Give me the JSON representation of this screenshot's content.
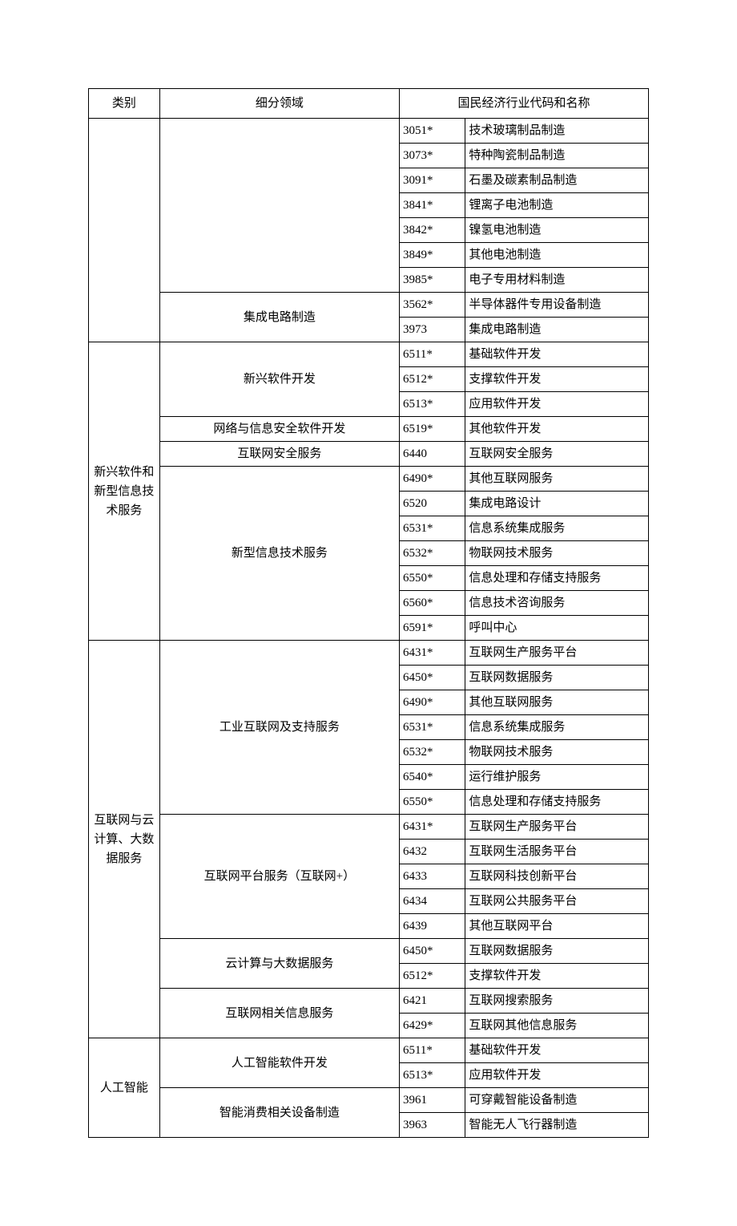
{
  "headers": {
    "category": "类别",
    "subfield": "细分领域",
    "codeName": "国民经济行业代码和名称"
  },
  "rows": [
    {
      "cat": "",
      "catSpan": 9,
      "sub": "",
      "subSpan": 7,
      "code": "3051*",
      "name": "技术玻璃制品制造"
    },
    {
      "code": "3073*",
      "name": "特种陶瓷制品制造"
    },
    {
      "code": "3091*",
      "name": "石墨及碳素制品制造"
    },
    {
      "code": "3841*",
      "name": "锂离子电池制造"
    },
    {
      "code": "3842*",
      "name": "镍氢电池制造"
    },
    {
      "code": "3849*",
      "name": "其他电池制造"
    },
    {
      "code": "3985*",
      "name": "电子专用材料制造"
    },
    {
      "sub": "集成电路制造",
      "subSpan": 2,
      "code": "3562*",
      "name": "半导体器件专用设备制造"
    },
    {
      "code": "3973",
      "name": "集成电路制造"
    },
    {
      "cat": "新兴软件和新型信息技术服务",
      "catSpan": 12,
      "sub": "新兴软件开发",
      "subSpan": 3,
      "code": "6511*",
      "name": "基础软件开发"
    },
    {
      "code": "6512*",
      "name": "支撑软件开发"
    },
    {
      "code": "6513*",
      "name": "应用软件开发"
    },
    {
      "sub": "网络与信息安全软件开发",
      "subSpan": 1,
      "code": "6519*",
      "name": "其他软件开发"
    },
    {
      "sub": "互联网安全服务",
      "subSpan": 1,
      "code": "6440",
      "name": "互联网安全服务"
    },
    {
      "sub": "新型信息技术服务",
      "subSpan": 7,
      "code": "6490*",
      "name": "其他互联网服务"
    },
    {
      "code": "6520",
      "name": "集成电路设计"
    },
    {
      "code": "6531*",
      "name": "信息系统集成服务"
    },
    {
      "code": "6532*",
      "name": "物联网技术服务"
    },
    {
      "code": "6550*",
      "name": "信息处理和存储支持服务"
    },
    {
      "code": "6560*",
      "name": "信息技术咨询服务"
    },
    {
      "code": "6591*",
      "name": "呼叫中心"
    },
    {
      "cat": "互联网与云计算、大数据服务",
      "catSpan": 16,
      "sub": "工业互联网及支持服务",
      "subSpan": 7,
      "code": "6431*",
      "name": "互联网生产服务平台"
    },
    {
      "code": "6450*",
      "name": "互联网数据服务"
    },
    {
      "code": "6490*",
      "name": "其他互联网服务"
    },
    {
      "code": "6531*",
      "name": "信息系统集成服务"
    },
    {
      "code": "6532*",
      "name": "物联网技术服务"
    },
    {
      "code": "6540*",
      "name": "运行维护服务"
    },
    {
      "code": "6550*",
      "name": "信息处理和存储支持服务"
    },
    {
      "sub": "互联网平台服务（互联网+）",
      "subSpan": 5,
      "code": "6431*",
      "name": "互联网生产服务平台"
    },
    {
      "code": "6432",
      "name": "互联网生活服务平台"
    },
    {
      "code": "6433",
      "name": "互联网科技创新平台"
    },
    {
      "code": "6434",
      "name": "互联网公共服务平台"
    },
    {
      "code": "6439",
      "name": "其他互联网平台"
    },
    {
      "sub": "云计算与大数据服务",
      "subSpan": 2,
      "code": "6450*",
      "name": "互联网数据服务"
    },
    {
      "code": "6512*",
      "name": "支撑软件开发"
    },
    {
      "sub": "互联网相关信息服务",
      "subSpan": 2,
      "code": "6421",
      "name": "互联网搜索服务"
    },
    {
      "code": "6429*",
      "name": "互联网其他信息服务"
    },
    {
      "cat": "人工智能",
      "catSpan": 4,
      "sub": "人工智能软件开发",
      "subSpan": 2,
      "code": "6511*",
      "name": "基础软件开发"
    },
    {
      "code": "6513*",
      "name": "应用软件开发"
    },
    {
      "sub": "智能消费相关设备制造",
      "subSpan": 2,
      "code": "3961",
      "name": "可穿戴智能设备制造"
    },
    {
      "code": "3963",
      "name": "智能无人飞行器制造"
    }
  ]
}
